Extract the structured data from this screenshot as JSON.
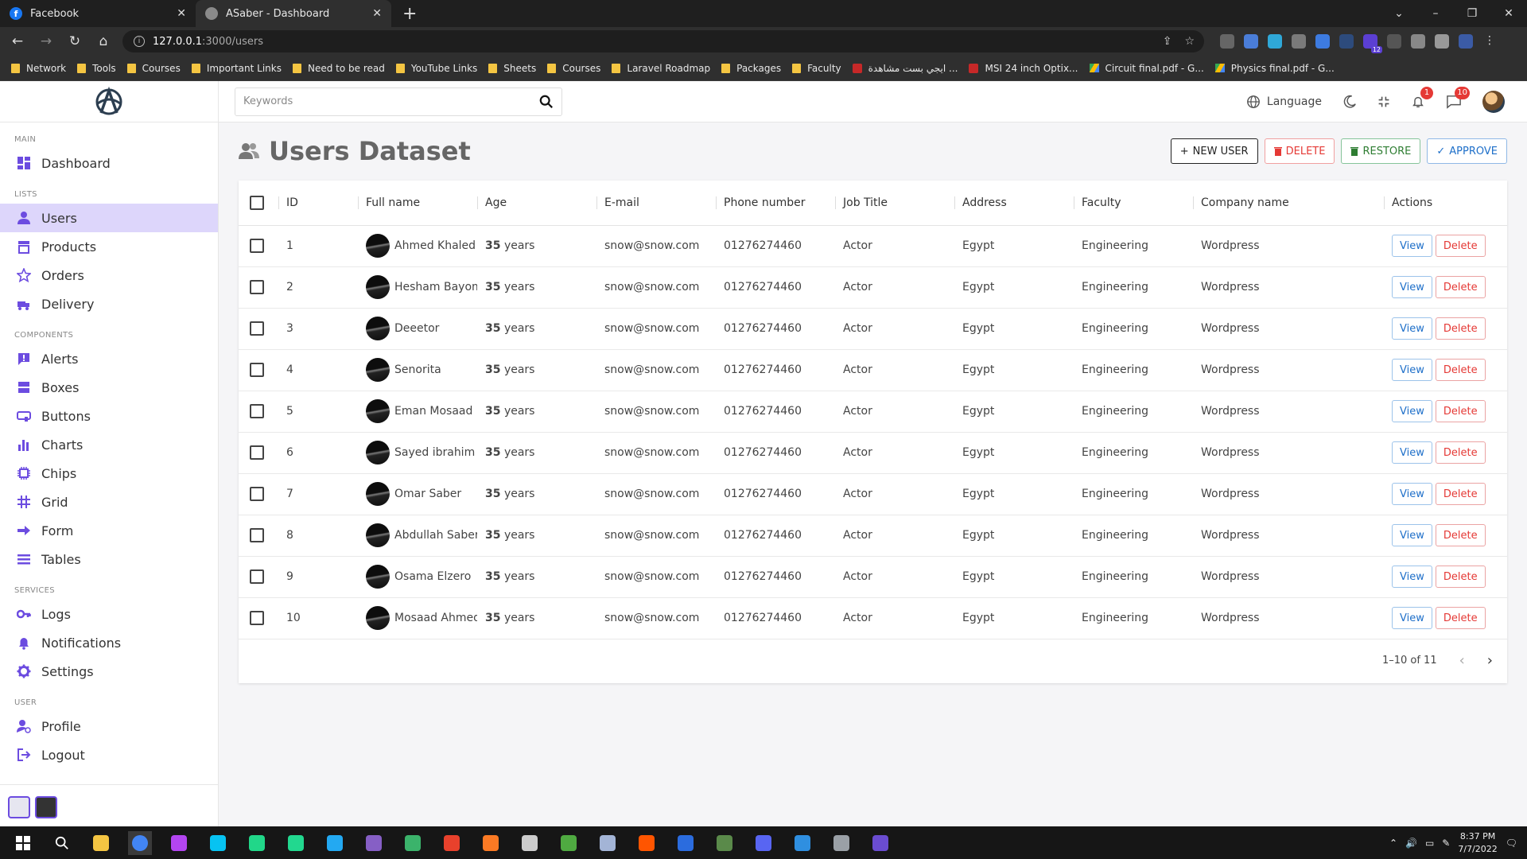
{
  "browser": {
    "tabs": [
      {
        "title": "Facebook",
        "favicon_color": "#1877f2",
        "favicon_text": "f",
        "close": "✕"
      },
      {
        "title": "ASaber - Dashboard",
        "favicon_color": "#8a8a8a",
        "favicon_text": "",
        "close": "✕"
      }
    ],
    "new_tab": "+",
    "url_host": "127.0.0.1",
    "url_rest": ":3000/users",
    "bookmarks": [
      {
        "label": "Network",
        "type": "folder"
      },
      {
        "label": "Tools",
        "type": "folder"
      },
      {
        "label": "Courses",
        "type": "folder"
      },
      {
        "label": "Important Links",
        "type": "folder"
      },
      {
        "label": "Need to be read",
        "type": "folder"
      },
      {
        "label": "YouTube Links",
        "type": "folder"
      },
      {
        "label": "Sheets",
        "type": "folder"
      },
      {
        "label": "Courses",
        "type": "folder"
      },
      {
        "label": "Laravel Roadmap",
        "type": "folder"
      },
      {
        "label": "Packages",
        "type": "folder"
      },
      {
        "label": "Faculty",
        "type": "folder"
      },
      {
        "label": "ايجي بست مشاهدة ...",
        "type": "page"
      },
      {
        "label": "MSI 24 inch Optix...",
        "type": "page"
      },
      {
        "label": "Circuit final.pdf - G...",
        "type": "drive"
      },
      {
        "label": "Physics final.pdf - G...",
        "type": "drive"
      }
    ],
    "extension_badge": "12"
  },
  "sidebar": {
    "sections": [
      {
        "title": "MAIN",
        "items": [
          {
            "label": "Dashboard",
            "icon": "dashboard-icon",
            "active": false
          }
        ]
      },
      {
        "title": "LISTS",
        "items": [
          {
            "label": "Users",
            "icon": "user-icon",
            "active": true
          },
          {
            "label": "Products",
            "icon": "store-icon",
            "active": false
          },
          {
            "label": "Orders",
            "icon": "star-icon",
            "active": false
          },
          {
            "label": "Delivery",
            "icon": "delivery-icon",
            "active": false
          }
        ]
      },
      {
        "title": "COMPONENTS",
        "items": [
          {
            "label": "Alerts",
            "icon": "alert-icon",
            "active": false
          },
          {
            "label": "Boxes",
            "icon": "box-icon",
            "active": false
          },
          {
            "label": "Buttons",
            "icon": "button-icon",
            "active": false
          },
          {
            "label": "Charts",
            "icon": "chart-icon",
            "active": false
          },
          {
            "label": "Chips",
            "icon": "chip-icon",
            "active": false
          },
          {
            "label": "Grid",
            "icon": "grid-icon",
            "active": false
          },
          {
            "label": "Form",
            "icon": "form-icon",
            "active": false
          },
          {
            "label": "Tables",
            "icon": "table-icon",
            "active": false
          }
        ]
      },
      {
        "title": "SERVICES",
        "items": [
          {
            "label": "Logs",
            "icon": "key-icon",
            "active": false
          },
          {
            "label": "Notifications",
            "icon": "bell-icon",
            "active": false
          },
          {
            "label": "Settings",
            "icon": "gear-icon",
            "active": false
          }
        ]
      },
      {
        "title": "USER",
        "items": [
          {
            "label": "Profile",
            "icon": "profile-icon",
            "active": false
          },
          {
            "label": "Logout",
            "icon": "logout-icon",
            "active": false
          }
        ]
      }
    ]
  },
  "topbar": {
    "search_placeholder": "Keywords",
    "language_label": "Language",
    "notifications_count": "1",
    "messages_count": "10"
  },
  "page": {
    "title": "Users Dataset",
    "buttons": {
      "new_user": "NEW USER",
      "delete": "DELETE",
      "restore": "RESTORE",
      "approve": "APPROVE"
    }
  },
  "table": {
    "columns": [
      "ID",
      "Full name",
      "Age",
      "E-mail",
      "Phone number",
      "Job Title",
      "Address",
      "Faculty",
      "Company name",
      "Actions"
    ],
    "age_suffix": "years",
    "view_label": "View",
    "delete_label": "Delete",
    "rows": [
      {
        "id": "1",
        "name": "Ahmed Khaled",
        "age": "35",
        "email": "snow@snow.com",
        "phone": "01276274460",
        "job": "Actor",
        "address": "Egypt",
        "faculty": "Engineering",
        "company": "Wordpress"
      },
      {
        "id": "2",
        "name": "Hesham Bayomi",
        "age": "35",
        "email": "snow@snow.com",
        "phone": "01276274460",
        "job": "Actor",
        "address": "Egypt",
        "faculty": "Engineering",
        "company": "Wordpress"
      },
      {
        "id": "3",
        "name": "Deeetor",
        "age": "35",
        "email": "snow@snow.com",
        "phone": "01276274460",
        "job": "Actor",
        "address": "Egypt",
        "faculty": "Engineering",
        "company": "Wordpress"
      },
      {
        "id": "4",
        "name": "Senorita",
        "age": "35",
        "email": "snow@snow.com",
        "phone": "01276274460",
        "job": "Actor",
        "address": "Egypt",
        "faculty": "Engineering",
        "company": "Wordpress"
      },
      {
        "id": "5",
        "name": "Eman Mosaad",
        "age": "35",
        "email": "snow@snow.com",
        "phone": "01276274460",
        "job": "Actor",
        "address": "Egypt",
        "faculty": "Engineering",
        "company": "Wordpress"
      },
      {
        "id": "6",
        "name": "Sayed ibrahim",
        "age": "35",
        "email": "snow@snow.com",
        "phone": "01276274460",
        "job": "Actor",
        "address": "Egypt",
        "faculty": "Engineering",
        "company": "Wordpress"
      },
      {
        "id": "7",
        "name": "Omar Saber",
        "age": "35",
        "email": "snow@snow.com",
        "phone": "01276274460",
        "job": "Actor",
        "address": "Egypt",
        "faculty": "Engineering",
        "company": "Wordpress"
      },
      {
        "id": "8",
        "name": "Abdullah Saber",
        "age": "35",
        "email": "snow@snow.com",
        "phone": "01276274460",
        "job": "Actor",
        "address": "Egypt",
        "faculty": "Engineering",
        "company": "Wordpress"
      },
      {
        "id": "9",
        "name": "Osama Elzero",
        "age": "35",
        "email": "snow@snow.com",
        "phone": "01276274460",
        "job": "Actor",
        "address": "Egypt",
        "faculty": "Engineering",
        "company": "Wordpress"
      },
      {
        "id": "10",
        "name": "Mosaad Ahmed",
        "age": "35",
        "email": "snow@snow.com",
        "phone": "01276274460",
        "job": "Actor",
        "address": "Egypt",
        "faculty": "Engineering",
        "company": "Wordpress"
      }
    ],
    "pagination": "1–10 of 11"
  },
  "taskbar": {
    "apps": [
      {
        "name": "file-explorer-icon",
        "color": "#f4c542"
      },
      {
        "name": "chrome-icon",
        "color": "#4285f4"
      },
      {
        "name": "phpstorm-icon",
        "color": "#b345f1"
      },
      {
        "name": "webstorm-icon",
        "color": "#07c3f2"
      },
      {
        "name": "pycharm-icon",
        "color": "#21d789"
      },
      {
        "name": "clion-icon",
        "color": "#22d88f"
      },
      {
        "name": "vscode-icon",
        "color": "#23a9f2"
      },
      {
        "name": "visual-studio-icon",
        "color": "#865fc5"
      },
      {
        "name": "globe-app-icon",
        "color": "#3bb36b"
      },
      {
        "name": "office-icon",
        "color": "#e8412c"
      },
      {
        "name": "xampp-icon",
        "color": "#fb7a24"
      },
      {
        "name": "ride-icon",
        "color": "#cccccc"
      },
      {
        "name": "mongodb-icon",
        "color": "#4faa41"
      },
      {
        "name": "cloud-app-icon",
        "color": "#a3b4d6"
      },
      {
        "name": "soundcloud-icon",
        "color": "#ff5500"
      },
      {
        "name": "word-app-icon",
        "color": "#2b6cde"
      },
      {
        "name": "notebook-icon",
        "color": "#5a8a4a"
      },
      {
        "name": "discord-icon",
        "color": "#5865f2"
      },
      {
        "name": "postman-icon",
        "color": "#2f8fe0"
      },
      {
        "name": "archive-icon",
        "color": "#9aa0a6"
      },
      {
        "name": "nox-icon",
        "color": "#6a4cd0"
      }
    ],
    "time": "8:37 PM",
    "date": "7/7/2022"
  },
  "colors": {
    "accent": "#6c4ce0",
    "active_nav_bg": "#ddd6fb"
  }
}
